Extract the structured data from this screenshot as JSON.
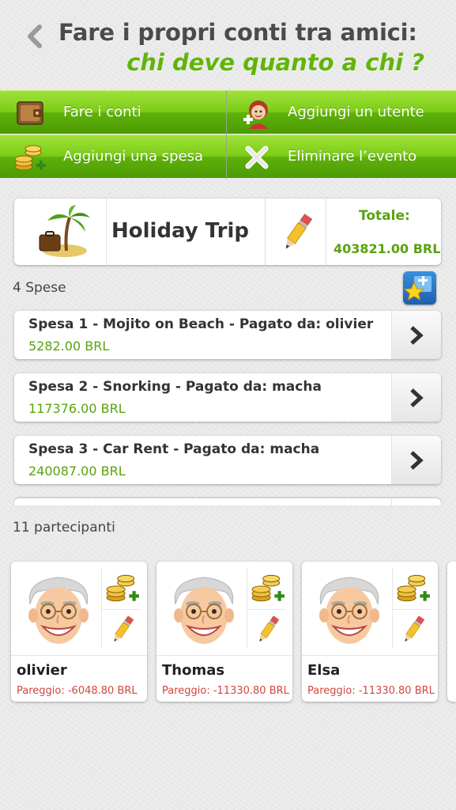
{
  "header": {
    "title_line1": "Fare i propri conti tra amici:",
    "title_line2": "chi deve quanto a chi ?"
  },
  "menu": {
    "items": [
      {
        "label": "Fare i conti",
        "icon": "wallet-icon"
      },
      {
        "label": "Aggiungi un utente",
        "icon": "add-user-icon"
      },
      {
        "label": "Aggiungi una spesa",
        "icon": "add-coins-icon"
      },
      {
        "label": "Eliminare l’evento",
        "icon": "delete-x-icon"
      }
    ]
  },
  "event": {
    "name": "Holiday Trip",
    "icon": "palm-island-icon",
    "total_label": "Totale:",
    "total_value": "403821.00 BRL"
  },
  "expenses": {
    "count_label": "4 Spese",
    "items": [
      {
        "title": "Spesa 1 - Mojito on Beach - Pagato da: olivier",
        "amount": "5282.00 BRL"
      },
      {
        "title": "Spesa 2 - Snorking - Pagato da: macha",
        "amount": "117376.00 BRL"
      },
      {
        "title": "Spesa 3 - Car Rent - Pagato da: macha",
        "amount": "240087.00 BRL"
      }
    ]
  },
  "participants": {
    "count_label": "11 partecipanti",
    "items": [
      {
        "name": "olivier",
        "balance": "Pareggio: -6048.80 BRL"
      },
      {
        "name": "Thomas",
        "balance": "Pareggio: -11330.80 BRL"
      },
      {
        "name": "Elsa",
        "balance": "Pareggio: -11330.80 BRL"
      }
    ]
  },
  "colors": {
    "accent_green": "#62b40c",
    "button_green": "#7ccd16",
    "balance_red": "#d0473f"
  }
}
